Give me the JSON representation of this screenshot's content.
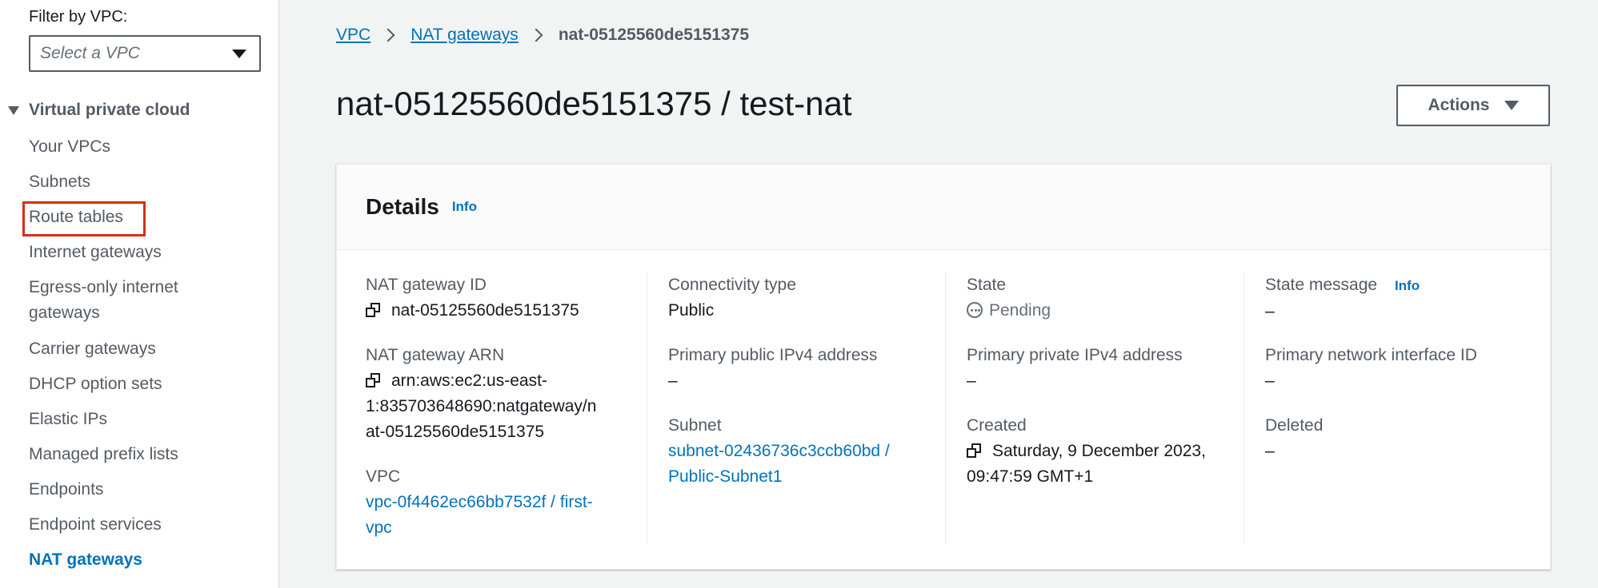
{
  "sidebar": {
    "filter_label": "Filter by VPC:",
    "select_placeholder": "Select a VPC",
    "section_title": "Virtual private cloud",
    "items": [
      {
        "label": "Your VPCs"
      },
      {
        "label": "Subnets"
      },
      {
        "label": "Route tables"
      },
      {
        "label": "Internet gateways"
      },
      {
        "label": "Egress-only internet",
        "label2": "gateways"
      },
      {
        "label": "Carrier gateways"
      },
      {
        "label": "DHCP option sets"
      },
      {
        "label": "Elastic IPs"
      },
      {
        "label": "Managed prefix lists"
      },
      {
        "label": "Endpoints"
      },
      {
        "label": "Endpoint services"
      },
      {
        "label": "NAT gateways"
      }
    ]
  },
  "breadcrumb": {
    "vpc": "VPC",
    "nat_gateways": "NAT gateways",
    "current": "nat-05125560de5151375"
  },
  "page_title": "nat-05125560de5151375 / test-nat",
  "actions_label": "Actions",
  "details": {
    "title": "Details",
    "info": "Info",
    "nat_id_label": "NAT gateway ID",
    "nat_id_value": "nat-05125560de5151375",
    "nat_arn_label": "NAT gateway ARN",
    "nat_arn_line1": "arn:aws:ec2:us-east-",
    "nat_arn_line2": "1:835703648690:natgateway/n",
    "nat_arn_line3": "at-05125560de5151375",
    "vpc_label": "VPC",
    "vpc_line1": "vpc-0f4462ec66bb7532f / first-",
    "vpc_line2": "vpc",
    "connectivity_label": "Connectivity type",
    "connectivity_value": "Public",
    "public_ip_label": "Primary public IPv4 address",
    "public_ip_value": "–",
    "subnet_label": "Subnet",
    "subnet_line1": "subnet-02436736c3ccb60bd /",
    "subnet_line2": "Public-Subnet1",
    "state_label": "State",
    "state_value": "Pending",
    "private_ip_label": "Primary private IPv4 address",
    "private_ip_value": "–",
    "created_label": "Created",
    "created_line1": "Saturday, 9 December 2023,",
    "created_line2": "09:47:59 GMT+1",
    "state_message_label": "State message",
    "state_message_info": "Info",
    "state_message_value": "–",
    "eni_label": "Primary network interface ID",
    "eni_value": "–",
    "deleted_label": "Deleted",
    "deleted_value": "–"
  },
  "colors": {
    "link": "#0073bb",
    "highlight": "#d13212"
  }
}
